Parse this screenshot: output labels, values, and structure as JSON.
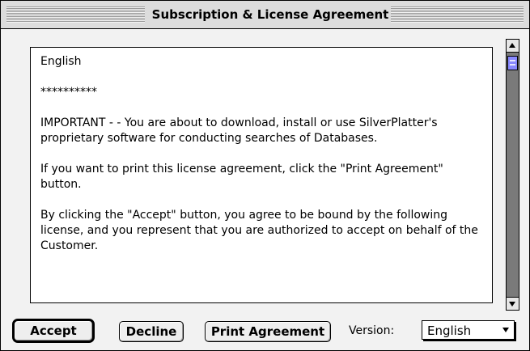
{
  "window": {
    "title": "Subscription & License Agreement"
  },
  "license_text": {
    "paragraphs": [
      "English",
      "**********",
      "IMPORTANT - - You are about to download, install or use SilverPlatter's proprietary software for conducting searches of Databases.",
      "If you want to print this license agreement, click the \"Print Agreement\" button.",
      "By clicking the \"Accept\" button, you agree to be bound by the following license, and you represent that you are authorized to accept on behalf of the Customer."
    ]
  },
  "buttons": {
    "accept": "Accept",
    "decline": "Decline",
    "print": "Print Agreement"
  },
  "version": {
    "label": "Version:",
    "selected": "English"
  },
  "scrollbar": {
    "position": 0.0
  },
  "colors": {
    "thumb": "#8888ff",
    "track": "#7a7a7a"
  }
}
